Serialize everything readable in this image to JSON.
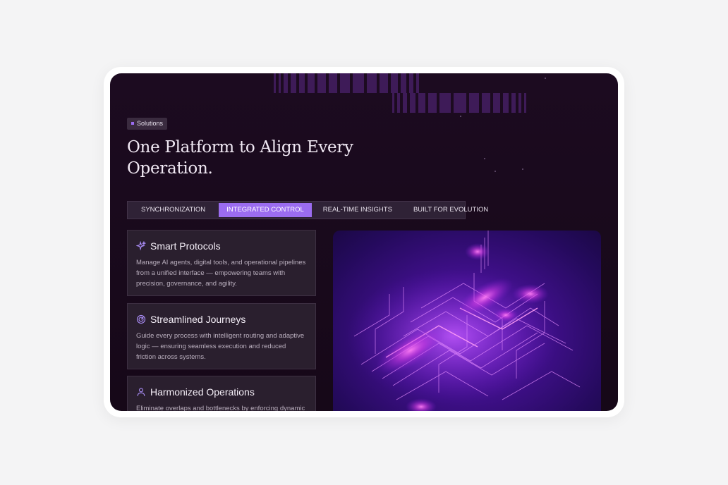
{
  "badge": {
    "label": "Solutions"
  },
  "hero": {
    "title": "One Platform to Align Every Operation."
  },
  "tabs": [
    {
      "label": "SYNCHRONIZATION",
      "active": false
    },
    {
      "label": "INTEGRATED CONTROL",
      "active": true
    },
    {
      "label": "REAL-TIME INSIGHTS",
      "active": false
    },
    {
      "label": "BUILT FOR EVOLUTION",
      "active": false
    }
  ],
  "features": [
    {
      "icon": "sparkles-icon",
      "title": "Smart Protocols",
      "description": "Manage AI agents, digital tools, and operational pipelines from a unified interface — empowering teams with precision, governance, and agility."
    },
    {
      "icon": "target-icon",
      "title": "Streamlined Journeys",
      "description": "Guide every process with intelligent routing and adaptive logic — ensuring seamless execution and reduced friction across systems."
    },
    {
      "icon": "users-icon",
      "title": "Harmonized Operations",
      "description": "Eliminate overlaps and bottlenecks by enforcing dynamic"
    }
  ],
  "colors": {
    "accent": "#9b6cf0",
    "background": "#1c0b20",
    "card": "#2a1f2e"
  }
}
